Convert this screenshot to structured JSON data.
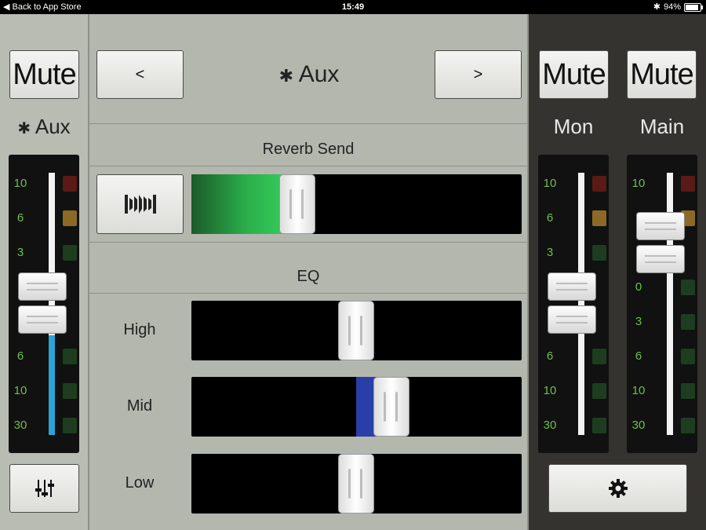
{
  "status_bar": {
    "back_label": "◀ Back to App Store",
    "time": "15:49",
    "bluetooth_glyph": "✱",
    "battery": "94%"
  },
  "left_channel": {
    "mute_label": "Mute",
    "name": "Aux",
    "scale": [
      "10",
      "6",
      "3",
      "0",
      "3",
      "6",
      "10",
      "30"
    ],
    "fader_level_pct": 55,
    "mixer_icon": "mixer-sliders-icon"
  },
  "center": {
    "prev_label": "<",
    "next_label": ">",
    "title": "Aux",
    "reverb_title": "Reverb Send",
    "reverb_button_icon": "reverb-icon",
    "reverb_level_pct": 28,
    "eq_title": "EQ",
    "eq_bands": [
      {
        "label": "High",
        "value_pct": 50
      },
      {
        "label": "Mid",
        "value_pct": 60
      },
      {
        "label": "Low",
        "value_pct": 50
      }
    ]
  },
  "right_channels": [
    {
      "mute_label": "Mute",
      "name": "Mon",
      "scale": [
        "10",
        "6",
        "3",
        "0",
        "3",
        "6",
        "10",
        "30"
      ],
      "fader_level_pct": 55
    },
    {
      "mute_label": "Mute",
      "name": "Main",
      "scale": [
        "10",
        "6",
        "3",
        "0",
        "3",
        "6",
        "10",
        "30"
      ],
      "fader_level_pct": 78
    }
  ],
  "settings_icon": "gear-icon",
  "colors": {
    "meter_text": "#6fbf4a",
    "reverb_fill": "#2ab04a",
    "mid_fill": "#2a3ea8",
    "aux_fader_fill": "#2aa3d6"
  }
}
